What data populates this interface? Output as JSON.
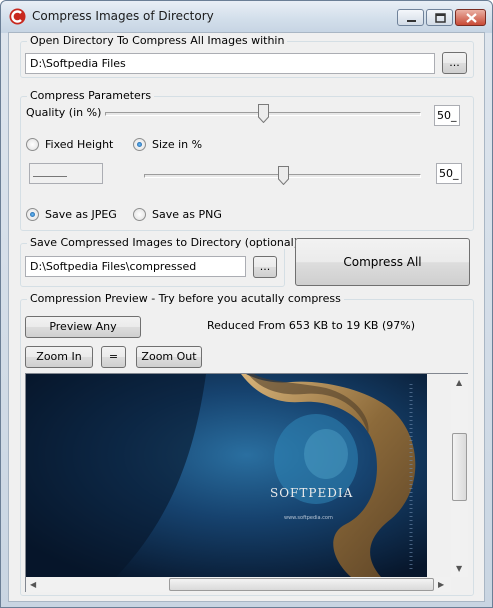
{
  "window": {
    "title": "Compress Images of Directory"
  },
  "source": {
    "group_label": "Open Directory To Compress All Images within",
    "path": "D:\\Softpedia Files",
    "browse_label": "..."
  },
  "params": {
    "group_label": "Compress Parameters",
    "quality_label": "Quality (in %)",
    "quality_value": "50",
    "quality_percent": 50,
    "fixed_height_label": "Fixed Height",
    "size_percent_label": "Size in %",
    "size_mode": "size_in_percent",
    "size_value": "50",
    "size_percent": 50,
    "height_value": "",
    "save_jpeg_label": "Save as JPEG",
    "save_png_label": "Save as PNG",
    "save_format": "jpeg"
  },
  "destination": {
    "group_label": "Save Compressed Images to Directory (optional)",
    "path": "D:\\Softpedia Files\\compressed",
    "browse_label": "..."
  },
  "compress_all_label": "Compress All",
  "preview": {
    "group_label": "Compression Preview - Try before you acutally compress",
    "preview_any_label": "Preview Any",
    "result_text": "Reduced From 653 KB to 19 KB (97%)",
    "zoom_in_label": "Zoom In",
    "zoom_reset_label": "=",
    "zoom_out_label": "Zoom Out",
    "image_caption": "SOFTPEDIA",
    "image_url_text": "www.softpedia.com"
  },
  "colors": {
    "accent": "#0d4b8f",
    "ocean_dark": "#0b1f3a",
    "ocean_mid": "#1f5e8f",
    "land": "#b08850"
  }
}
